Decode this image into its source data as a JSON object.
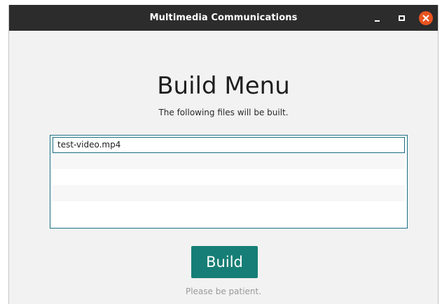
{
  "window": {
    "title": "Multimedia Communications",
    "controls": {
      "minimize": "minimize-icon",
      "maximize": "maximize-icon",
      "close": "close-icon"
    },
    "close_color": "#e95420",
    "titlebar_color": "#2c2c2c"
  },
  "main": {
    "heading": "Build Menu",
    "subtitle": "The following files will be built.",
    "files": [
      {
        "label": "test-video.mp4"
      },
      {
        "label": ""
      },
      {
        "label": ""
      },
      {
        "label": ""
      },
      {
        "label": ""
      }
    ],
    "build_label": "Build",
    "hint": "Please be patient.",
    "accent_color": "#167e76",
    "list_border_color": "#1a6e80"
  }
}
